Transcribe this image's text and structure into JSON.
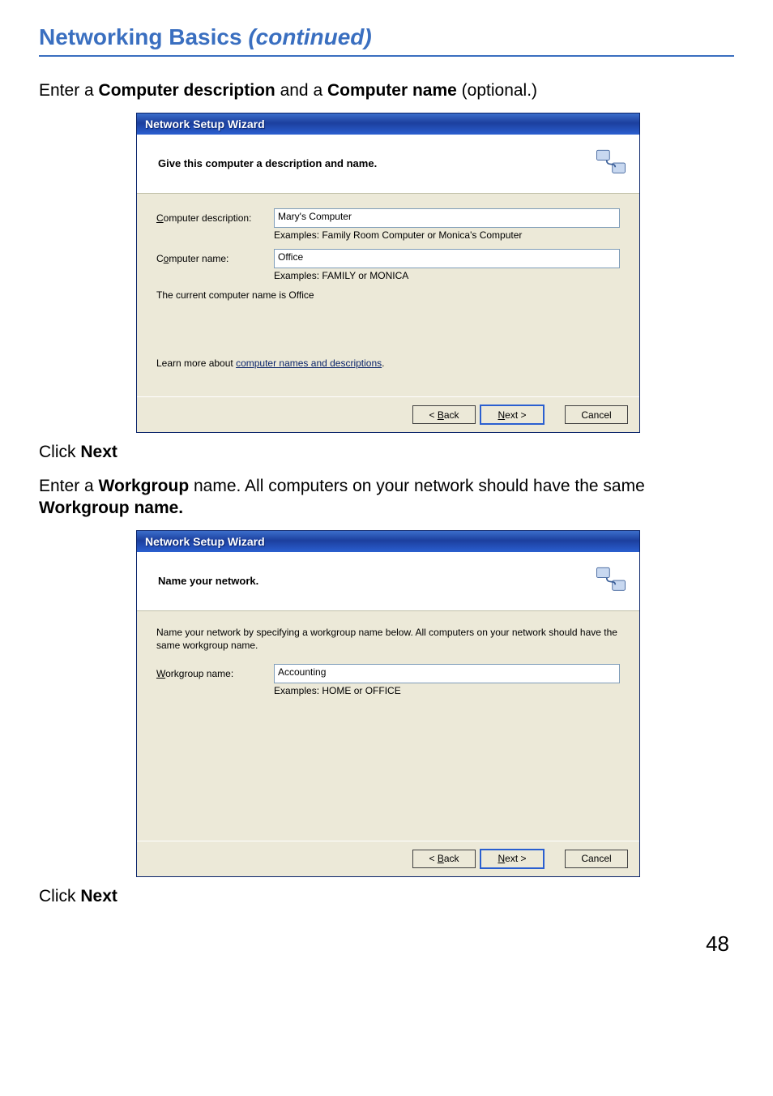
{
  "page_title": "Networking Basics ",
  "page_title_cont": "(continued)",
  "intro1_pre": "Enter a ",
  "intro1_b1": "Computer description",
  "intro1_mid": " and a ",
  "intro1_b2": "Computer name",
  "intro1_post": " (optional.)",
  "click_next_pre": "Click ",
  "click_next_b": "Next",
  "intro2_pre": "Enter a ",
  "intro2_b1": "Workgroup",
  "intro2_mid": " name.  All computers on your network should have the same ",
  "intro2_b2": "Workgroup name.",
  "page_number": "48",
  "wizard1": {
    "titlebar": "Network Setup Wizard",
    "header": "Give this computer a description and name.",
    "desc_label_u": "C",
    "desc_label_rest": "omputer description:",
    "desc_value": "Mary's Computer",
    "desc_example": "Examples: Family Room Computer or Monica's Computer",
    "name_label_pre": "C",
    "name_label_u": "o",
    "name_label_rest": "mputer name:",
    "name_value": "Office",
    "name_example": "Examples: FAMILY or MONICA",
    "current_pre": "The current computer name is   ",
    "current_val": "Office",
    "learn_pre": "Learn more about ",
    "learn_link": "computer names and descriptions",
    "learn_post": ".",
    "back_u": "B",
    "back_rest": "ack",
    "next_u": "N",
    "next_rest": "ext >",
    "cancel": "Cancel"
  },
  "wizard2": {
    "titlebar": "Network Setup Wizard",
    "header": "Name your network.",
    "instr": "Name your network by specifying a workgroup name below. All computers on your network should have the same workgroup name.",
    "wg_label_u": "W",
    "wg_label_rest": "orkgroup name:",
    "wg_value": "Accounting",
    "wg_example": "Examples: HOME or OFFICE",
    "back_u": "B",
    "back_rest": "ack",
    "next_u": "N",
    "next_rest": "ext >",
    "cancel": "Cancel"
  }
}
